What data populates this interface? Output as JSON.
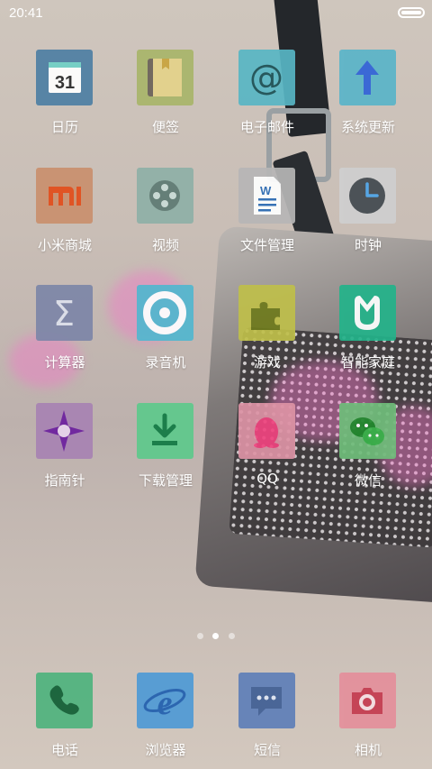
{
  "status_bar": {
    "time": "20:41",
    "battery_icon": "battery-icon"
  },
  "apps": [
    {
      "label": "日历",
      "icon": "calendar-icon",
      "color": "#4e7fa4",
      "date_number": "31"
    },
    {
      "label": "便签",
      "icon": "notes-icon",
      "color": "#a9b56a"
    },
    {
      "label": "电子邮件",
      "icon": "email-icon",
      "color": "#58b6c4"
    },
    {
      "label": "系统更新",
      "icon": "update-arrow-icon",
      "color": "#5ab4c9"
    },
    {
      "label": "小米商城",
      "icon": "mi-store-icon",
      "color": "#c9906e"
    },
    {
      "label": "视频",
      "icon": "video-reel-icon",
      "color": "#8fb0a7"
    },
    {
      "label": "文件管理",
      "icon": "document-icon",
      "color": "#b7b6b6"
    },
    {
      "label": "时钟",
      "icon": "clock-icon",
      "color": "#cfcfcf"
    },
    {
      "label": "计算器",
      "icon": "sigma-icon",
      "color": "#7d86a8"
    },
    {
      "label": "录音机",
      "icon": "recorder-icon",
      "color": "#52b7cf"
    },
    {
      "label": "游戏",
      "icon": "puzzle-icon",
      "color": "#bfbf4a"
    },
    {
      "label": "智能家庭",
      "icon": "mijia-icon",
      "color": "#23b38a"
    },
    {
      "label": "指南针",
      "icon": "compass-icon",
      "color": "#a883b3"
    },
    {
      "label": "下载管理",
      "icon": "download-icon",
      "color": "#5ec98c"
    },
    {
      "label": "QQ",
      "icon": "qq-penguin-icon",
      "color": "#dd93a5"
    },
    {
      "label": "微信",
      "icon": "wechat-icon",
      "color": "#6fbd7a"
    }
  ],
  "page_indicator": {
    "pages": 3,
    "active": 2
  },
  "dock": [
    {
      "label": "电话",
      "icon": "phone-icon",
      "color": "#4fb37e"
    },
    {
      "label": "浏览器",
      "icon": "browser-icon",
      "color": "#4f9ad6"
    },
    {
      "label": "短信",
      "icon": "message-icon",
      "color": "#5f7fb8"
    },
    {
      "label": "相机",
      "icon": "camera-icon",
      "color": "#e48f9b"
    }
  ]
}
